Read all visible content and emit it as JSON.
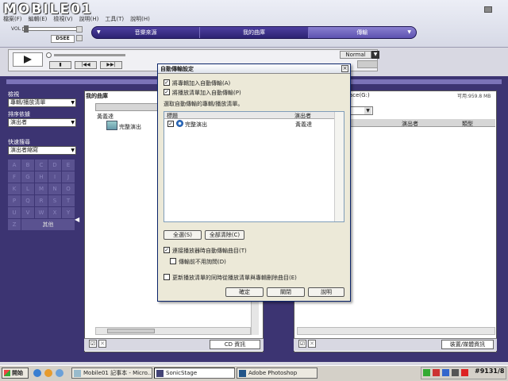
{
  "app": {
    "logo_text": "MOBILE01",
    "menu": [
      "檔案(F)",
      "編輯(E)",
      "檢視(V)",
      "說明(H)",
      "工具(T)",
      "說明(H)"
    ],
    "vol_label": "VOL",
    "dsee_label": "DSEE"
  },
  "nav": {
    "tabs": [
      {
        "label": "音樂來源"
      },
      {
        "label": "我的曲庫"
      },
      {
        "label": "傳輸",
        "active": true
      }
    ]
  },
  "player": {
    "mode_value": "Normal",
    "prev_label": "|◀◀",
    "next_label": "▶▶|"
  },
  "left_panel": {
    "view_label": "檢視",
    "view_value": "專輯/播放清單",
    "sort_label": "排序依據",
    "sort_value": "演出者",
    "quick_search_label": "快速搜尋",
    "quick_search_value": "演出者縮寫",
    "alphabet": [
      "A",
      "B",
      "C",
      "D",
      "E",
      "F",
      "G",
      "H",
      "I",
      "J",
      "K",
      "L",
      "M",
      "N",
      "O",
      "P",
      "Q",
      "R",
      "S",
      "T",
      "U",
      "V",
      "W",
      "X",
      "Y",
      "Z"
    ],
    "other_label": "其他"
  },
  "library": {
    "title": "我的曲庫",
    "column_album": "相簿",
    "artist": "黃義達",
    "album": "完整演出",
    "cd_info_label": "CD 資訊"
  },
  "device": {
    "title": "ace(G:)",
    "free_space": "可用:959.8 MB",
    "columns": [
      "演出者",
      "類型"
    ],
    "info_label": "裝置/媒體資訊"
  },
  "dialog": {
    "title": "自動傳輸設定",
    "close_label": "×",
    "option_add_album": "將專輯加入自動傳輸(A)",
    "option_add_playlist": "將播放清單加入自動傳輸(P)",
    "instruction": "選取自動傳輸的專輯/播放清單。",
    "list_col_title": "標題",
    "list_col_artist": "演出者",
    "rows": [
      {
        "title": "完整演出",
        "artist": "黃義達",
        "checked": true
      }
    ],
    "select_all_label": "全選(S)",
    "clear_all_label": "全部清除(C)",
    "option_auto_on_connect": "連接播放器時自動傳輸曲目(T)",
    "option_no_confirm": "傳輸前不用詢問(D)",
    "option_update_delete": "更新播放清單的同時從播放清單與專輯刪除曲目(E)",
    "ok_label": "確定",
    "close_button_label": "關閉",
    "help_label": "說明"
  },
  "taskbar": {
    "start_label": "開始",
    "tasks": [
      {
        "label": "Mobile01 記事本 - Micro..."
      },
      {
        "label": "SonicStage",
        "active": true
      },
      {
        "label": "Adobe Photoshop"
      }
    ],
    "clock": "#9131/8"
  }
}
